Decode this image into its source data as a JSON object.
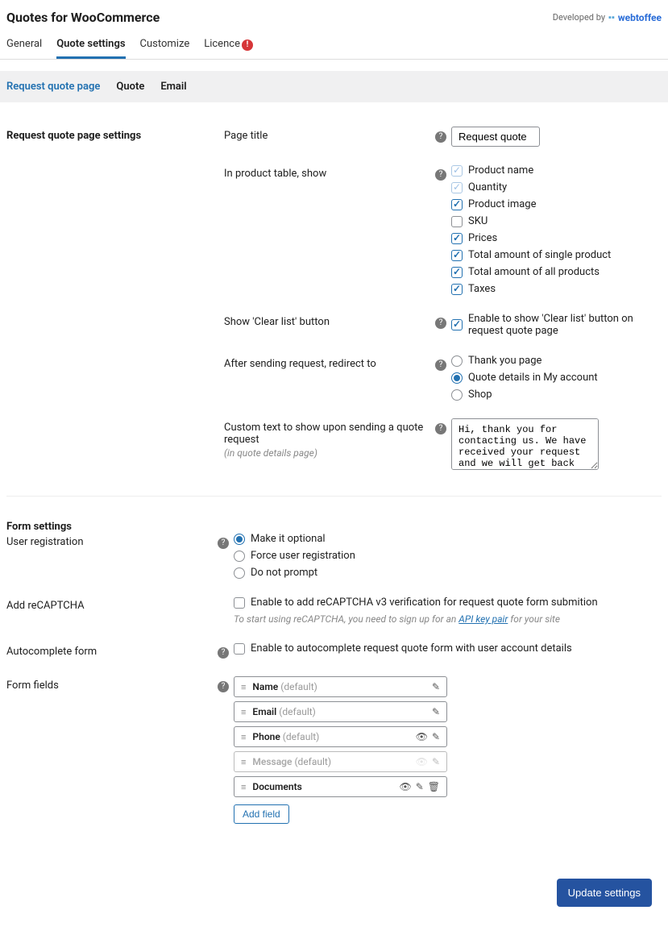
{
  "header": {
    "title": "Quotes for WooCommerce",
    "developed_by": "Developed by",
    "brand": "webtoffee"
  },
  "tabs": [
    "General",
    "Quote settings",
    "Customize",
    "Licence"
  ],
  "active_tab": 1,
  "licence_alert": "!",
  "subtabs": [
    "Request quote page",
    "Quote",
    "Email"
  ],
  "active_subtab": 0,
  "section1": {
    "title": "Request quote page settings",
    "page_title": {
      "label": "Page title",
      "value": "Request quote"
    },
    "product_table": {
      "label": "In product table, show",
      "options": [
        {
          "label": "Product name",
          "checked": true,
          "locked": true
        },
        {
          "label": "Quantity",
          "checked": true,
          "locked": true
        },
        {
          "label": "Product image",
          "checked": true,
          "locked": false
        },
        {
          "label": "SKU",
          "checked": false,
          "locked": false
        },
        {
          "label": "Prices",
          "checked": true,
          "locked": false
        },
        {
          "label": "Total amount of single product",
          "checked": true,
          "locked": false
        },
        {
          "label": "Total amount of all products",
          "checked": true,
          "locked": false
        },
        {
          "label": "Taxes",
          "checked": true,
          "locked": false
        }
      ]
    },
    "clear_list": {
      "label": "Show 'Clear list' button",
      "option": "Enable to show 'Clear list' button on request quote page",
      "checked": true
    },
    "redirect": {
      "label": "After sending request, redirect to",
      "options": [
        "Thank you page",
        "Quote details in My account",
        "Shop"
      ],
      "selected": 1
    },
    "custom_text": {
      "label": "Custom text to show upon sending a quote request",
      "sublabel": "(in quote details page)",
      "value": "Hi, thank you for contacting us. We have received your request and we will get back to you soon."
    }
  },
  "section2": {
    "title": "Form settings",
    "user_reg": {
      "label": "User registration",
      "options": [
        "Make it optional",
        "Force user registration",
        "Do not prompt"
      ],
      "selected": 0
    },
    "recaptcha": {
      "label": "Add reCAPTCHA",
      "option": "Enable to add reCAPTCHA v3 verification for request quote form submition",
      "checked": false,
      "note_pre": "To start using reCAPTCHA, you need to sign up for an ",
      "note_link": "API key pair",
      "note_post": " for your site"
    },
    "autocomplete": {
      "label": "Autocomplete form",
      "option": "Enable to autocomplete request quote form with user account details",
      "checked": false
    },
    "form_fields": {
      "label": "Form fields",
      "items": [
        {
          "name": "Name",
          "suffix": "(default)",
          "icons": [
            "edit"
          ],
          "muted": false
        },
        {
          "name": "Email",
          "suffix": "(default)",
          "icons": [
            "edit"
          ],
          "muted": false
        },
        {
          "name": "Phone",
          "suffix": "(default)",
          "icons": [
            "eye",
            "edit"
          ],
          "muted": false
        },
        {
          "name": "Message",
          "suffix": "(default)",
          "icons": [
            "eye-off",
            "edit"
          ],
          "muted": true
        },
        {
          "name": "Documents",
          "suffix": "",
          "icons": [
            "eye",
            "edit",
            "trash"
          ],
          "muted": false
        }
      ],
      "add_button": "Add field"
    }
  },
  "footer": {
    "update": "Update settings"
  }
}
